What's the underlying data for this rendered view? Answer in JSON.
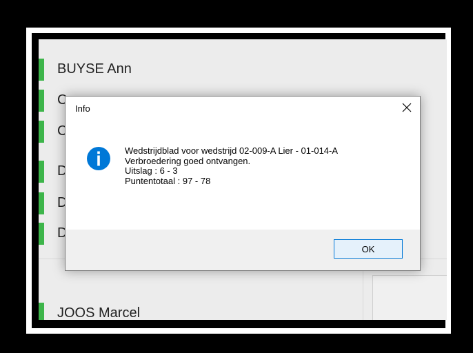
{
  "background_list": {
    "rows": [
      {
        "name": "BUYSE Ann"
      },
      {
        "name": "C"
      },
      {
        "name": "C"
      },
      {
        "name": "D"
      },
      {
        "name": "D"
      },
      {
        "name": "D"
      },
      {
        "name": "JOOS Marcel"
      }
    ],
    "status_color": "#3db54a"
  },
  "dialog": {
    "title": "Info",
    "icon": "info-icon",
    "accent": "#0078d7",
    "lines": [
      "Wedstrijdblad voor wedstrijd 02-009-A Lier - 01-014-A",
      "Verbroedering goed ontvangen.",
      "Uitslag : 6 - 3",
      "Puntentotaal : 97 - 78"
    ],
    "ok_label": "OK"
  }
}
